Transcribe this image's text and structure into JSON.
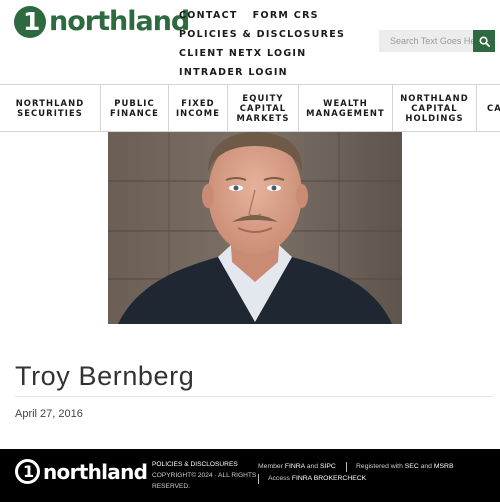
{
  "header": {
    "logo_text": "northland",
    "logo_mark": "1",
    "top_links_row1": [
      "CONTACT",
      "FORM CRS"
    ],
    "top_links_row2": [
      "POLICIES & DISCLOSURES"
    ],
    "top_links_row3": [
      "CLIENT NETX LOGIN"
    ],
    "top_links_row4": [
      "INTRADER LOGIN"
    ],
    "search": {
      "placeholder": "Search Text Goes Here",
      "value": "",
      "icon": "search-icon"
    }
  },
  "nav": {
    "items": [
      {
        "label": "NORTHLAND\nSECURITIES"
      },
      {
        "label": "PUBLIC\nFINANCE"
      },
      {
        "label": "FIXED\nINCOME"
      },
      {
        "label": "EQUITY\nCAPITAL\nMARKETS"
      },
      {
        "label": "WEALTH\nMANAGEMENT"
      },
      {
        "label": "NORTHLAND\nCAPITAL\nHOLDINGS"
      },
      {
        "label": "CA"
      }
    ]
  },
  "profile": {
    "name": "Troy Bernberg",
    "date": "April 27, 2016"
  },
  "footer": {
    "logo_text": "northland",
    "policies_link": "POLICIES & DISCLOSURES",
    "copyright": "COPYRIGHT© 2024 · ALL RIGHTS RESERVED.",
    "member_prefix": "Member",
    "finra": "FINRA",
    "and1": "and",
    "sipc": "SIPC",
    "registered_prefix": "Registered with",
    "sec": "SEC",
    "and2": "and",
    "msrb": "MSRB",
    "access_prefix": "Access",
    "brokercheck": "FINRA BROKERCHECK"
  },
  "colors": {
    "brand_green": "#2d6a3f",
    "footer_bg": "#000000"
  }
}
